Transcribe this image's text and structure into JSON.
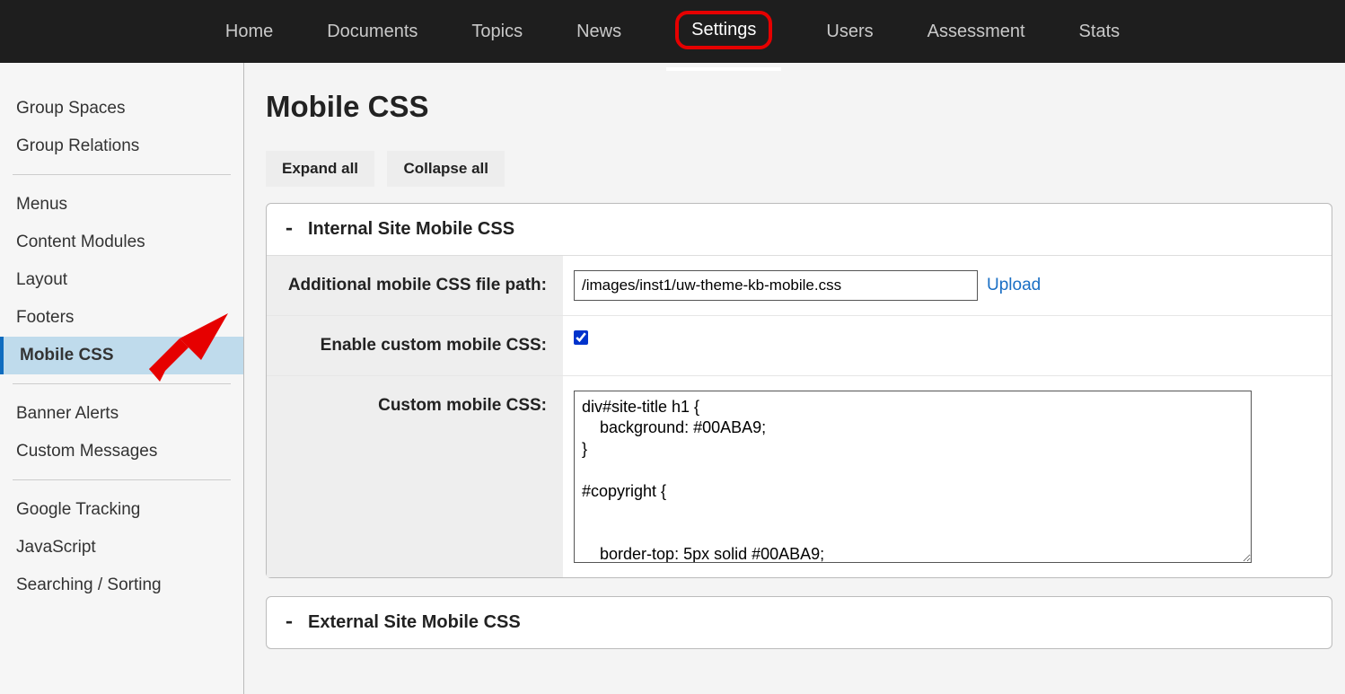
{
  "nav": {
    "items": [
      {
        "label": "Home"
      },
      {
        "label": "Documents"
      },
      {
        "label": "Topics"
      },
      {
        "label": "News"
      },
      {
        "label": "Settings",
        "active": true
      },
      {
        "label": "Users"
      },
      {
        "label": "Assessment"
      },
      {
        "label": "Stats"
      }
    ]
  },
  "sidebar": {
    "g0": [
      {
        "label": "Group Spaces"
      },
      {
        "label": "Group Relations"
      }
    ],
    "g1": [
      {
        "label": "Menus"
      },
      {
        "label": "Content Modules"
      },
      {
        "label": "Layout"
      },
      {
        "label": "Footers"
      },
      {
        "label": "Mobile CSS",
        "active": true
      }
    ],
    "g2": [
      {
        "label": "Banner Alerts"
      },
      {
        "label": "Custom Messages"
      }
    ],
    "g3": [
      {
        "label": "Google Tracking"
      },
      {
        "label": "JavaScript"
      },
      {
        "label": "Searching / Sorting"
      }
    ]
  },
  "page": {
    "title": "Mobile CSS",
    "expand_label": "Expand all",
    "collapse_label": "Collapse all"
  },
  "internal": {
    "toggle": "-",
    "heading": "Internal Site Mobile CSS",
    "path_label": "Additional mobile CSS file path:",
    "path_value": "/images/inst1/uw-theme-kb-mobile.css",
    "upload_label": "Upload",
    "enable_label": "Enable custom mobile CSS:",
    "enable_checked": true,
    "custom_label": "Custom mobile CSS:",
    "custom_value": "div#site-title h1 {\n    background: #00ABA9;\n}\n\n#copyright {\n\n\n    border-top: 5px solid #00ABA9;"
  },
  "external": {
    "toggle": "-",
    "heading": "External Site Mobile CSS"
  }
}
